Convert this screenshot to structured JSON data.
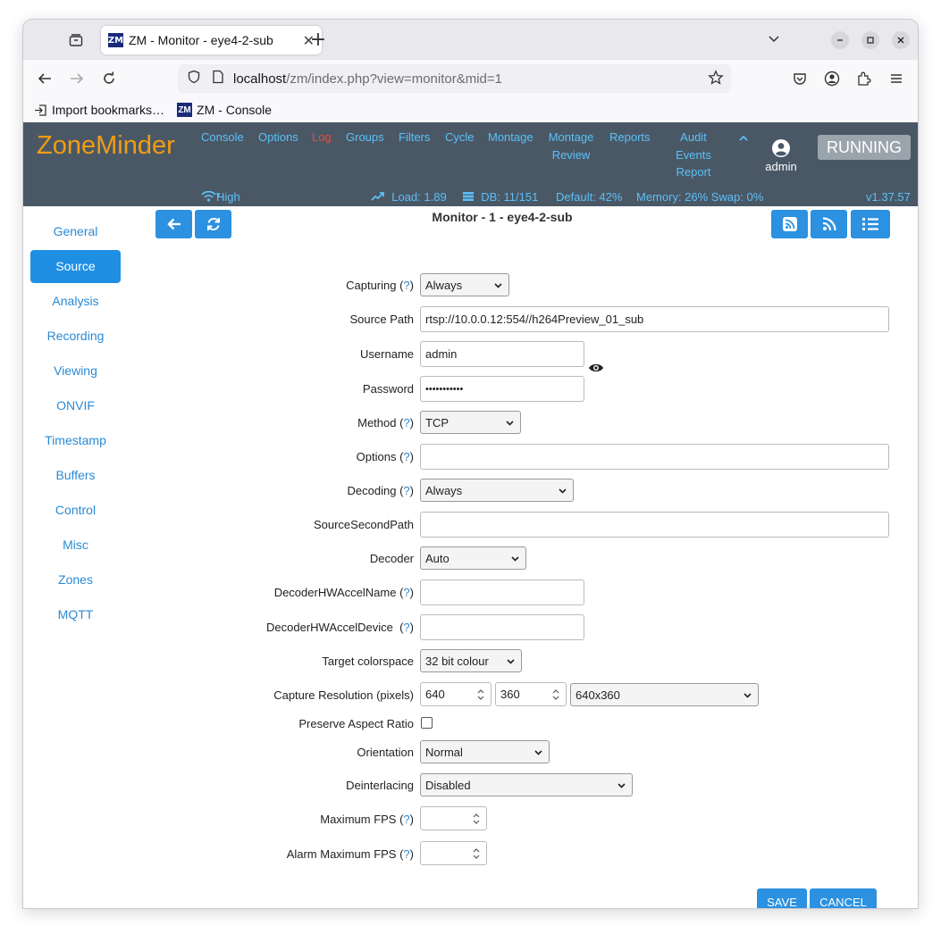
{
  "browser": {
    "tab_title": "ZM - Monitor - eye4-2-sub",
    "tab_favicon": "ZM",
    "url_host": "localhost",
    "url_path": "/zm/index.php?view=monitor&mid=1",
    "bookmarks": [
      {
        "label": "Import bookmarks…",
        "icon": "import-icon"
      },
      {
        "label": "ZM - Console",
        "icon": "ZM"
      }
    ]
  },
  "header": {
    "logo": "ZoneMinder",
    "menu": {
      "console": "Console",
      "options": "Options",
      "log": "Log",
      "groups": "Groups",
      "filters": "Filters",
      "cycle": "Cycle",
      "montage": "Montage",
      "montage_review_1": "Montage",
      "montage_review_2": "Review",
      "reports": "Reports",
      "audit_1": "Audit",
      "audit_2": "Events",
      "audit_3": "Report"
    },
    "user": "admin",
    "state": "RUNNING",
    "status": {
      "bandwidth": "High",
      "load": "Load: 1.89",
      "db": "DB: 11/151",
      "default": "Default: 42%",
      "memory": "Memory: 26% Swap: 0%",
      "version": "v1.37.57"
    },
    "colors": {
      "bg": "#4a5866",
      "logo": "#f39c12",
      "link": "#5bc0f8",
      "log": "#e74c3c"
    }
  },
  "page": {
    "title": "Monitor - 1 - eye4-2-sub"
  },
  "sidebar": {
    "items": [
      "General",
      "Source",
      "Analysis",
      "Recording",
      "Viewing",
      "ONVIF",
      "Timestamp",
      "Buffers",
      "Control",
      "Misc",
      "Zones",
      "MQTT"
    ],
    "active": "Source"
  },
  "form": {
    "capturing": {
      "label": "Capturing (",
      "q": "?",
      "end": ")",
      "value": "Always"
    },
    "source_path": {
      "label": "Source Path",
      "value": "rtsp://10.0.0.12:554//h264Preview_01_sub"
    },
    "username": {
      "label": "Username",
      "value": "admin"
    },
    "password": {
      "label": "Password",
      "value": "•••••••••••"
    },
    "method": {
      "label": "Method (",
      "q": "?",
      "end": ")",
      "value": "TCP"
    },
    "options": {
      "label": "Options (",
      "q": "?",
      "end": ")",
      "value": ""
    },
    "decoding": {
      "label": "Decoding (",
      "q": "?",
      "end": ")",
      "value": "Always"
    },
    "source_second_path": {
      "label": "SourceSecondPath",
      "value": ""
    },
    "decoder": {
      "label": "Decoder",
      "value": "Auto"
    },
    "hwaccel_name": {
      "label": "DecoderHWAccelName (",
      "q": "?",
      "end": ")",
      "value": ""
    },
    "hwaccel_device": {
      "label": "DecoderHWAccelDevice  (",
      "q": "?",
      "end": ")",
      "value": ""
    },
    "colorspace": {
      "label": "Target colorspace",
      "value": "32 bit colour"
    },
    "resolution": {
      "label": "Capture Resolution (pixels)",
      "width": "640",
      "height": "360",
      "preset": "640x360"
    },
    "aspect": {
      "label": "Preserve Aspect Ratio"
    },
    "orientation": {
      "label": "Orientation",
      "value": "Normal"
    },
    "deinterlacing": {
      "label": "Deinterlacing",
      "value": "Disabled"
    },
    "max_fps": {
      "label": "Maximum FPS (",
      "q": "?",
      "end": ")",
      "value": ""
    },
    "alarm_max_fps": {
      "label": "Alarm Maximum FPS (",
      "q": "?",
      "end": ")",
      "value": ""
    }
  },
  "actions": {
    "save": "SAVE",
    "cancel": "CANCEL"
  }
}
